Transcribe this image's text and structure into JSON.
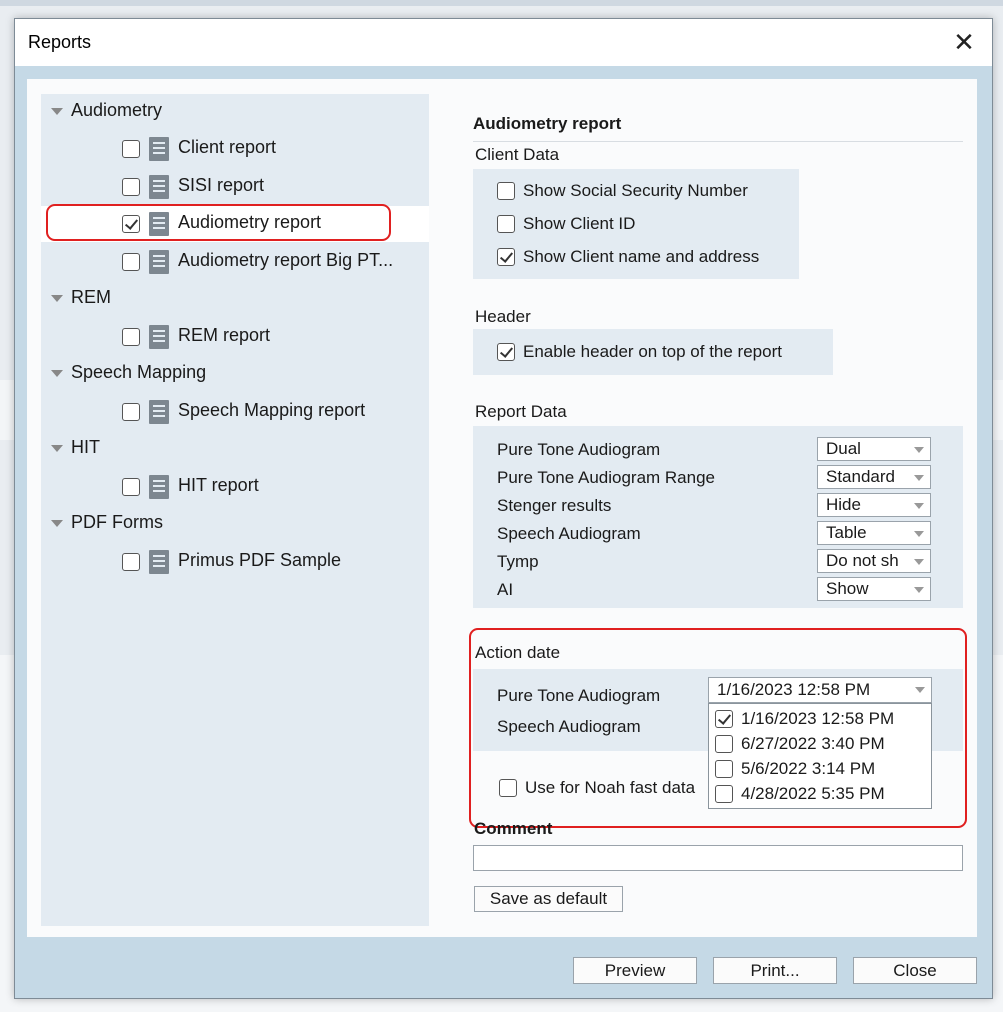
{
  "window": {
    "title": "Reports",
    "close_glyph": "✕"
  },
  "tree": {
    "categories": [
      {
        "label": "Audiometry",
        "items": [
          {
            "label": "Client report",
            "checked": false
          },
          {
            "label": "SISI report",
            "checked": false
          },
          {
            "label": "Audiometry report",
            "checked": true,
            "selected": true
          },
          {
            "label": "Audiometry report Big PT...",
            "checked": false
          }
        ]
      },
      {
        "label": "REM",
        "items": [
          {
            "label": "REM report",
            "checked": false
          }
        ]
      },
      {
        "label": "Speech Mapping",
        "items": [
          {
            "label": "Speech Mapping report",
            "checked": false
          }
        ]
      },
      {
        "label": "HIT",
        "items": [
          {
            "label": "HIT report",
            "checked": false
          }
        ]
      },
      {
        "label": "PDF Forms",
        "items": [
          {
            "label": "Primus PDF Sample",
            "checked": false
          }
        ]
      }
    ]
  },
  "panel": {
    "title": "Audiometry report",
    "client_data": {
      "label": "Client Data",
      "options": [
        {
          "label": "Show Social Security Number",
          "checked": false
        },
        {
          "label": "Show Client ID",
          "checked": false
        },
        {
          "label": "Show Client name and address",
          "checked": true
        }
      ]
    },
    "header": {
      "label": "Header",
      "option": {
        "label": "Enable header on top of the report",
        "checked": true
      }
    },
    "report_data": {
      "label": "Report Data",
      "rows": [
        {
          "label": "Pure Tone Audiogram",
          "value": "Dual"
        },
        {
          "label": "Pure Tone Audiogram Range",
          "value": "Standard"
        },
        {
          "label": "Stenger results",
          "value": "Hide"
        },
        {
          "label": "Speech Audiogram",
          "value": "Table"
        },
        {
          "label": "Tymp",
          "value": "Do not sh"
        },
        {
          "label": "AI",
          "value": "Show"
        }
      ]
    },
    "action_date": {
      "label": "Action date",
      "pure_tone_label": "Pure Tone Audiogram",
      "speech_label": "Speech Audiogram",
      "selected": "1/16/2023 12:58 PM",
      "options": [
        {
          "label": "1/16/2023 12:58 PM",
          "checked": true
        },
        {
          "label": "6/27/2022 3:40 PM",
          "checked": false
        },
        {
          "label": "5/6/2022 3:14 PM",
          "checked": false
        },
        {
          "label": "4/28/2022 5:35 PM",
          "checked": false
        }
      ],
      "noah": {
        "label": "Use for Noah fast data",
        "checked": false
      }
    },
    "comment": {
      "label": "Comment",
      "value": ""
    },
    "save_default_label": "Save as default"
  },
  "footer": {
    "preview_label": "Preview",
    "print_label": "Print...",
    "close_label": "Close"
  },
  "colors": {
    "highlight": "#e02020",
    "panel": "#e3ebf2",
    "frame": "#c5d9e6"
  }
}
